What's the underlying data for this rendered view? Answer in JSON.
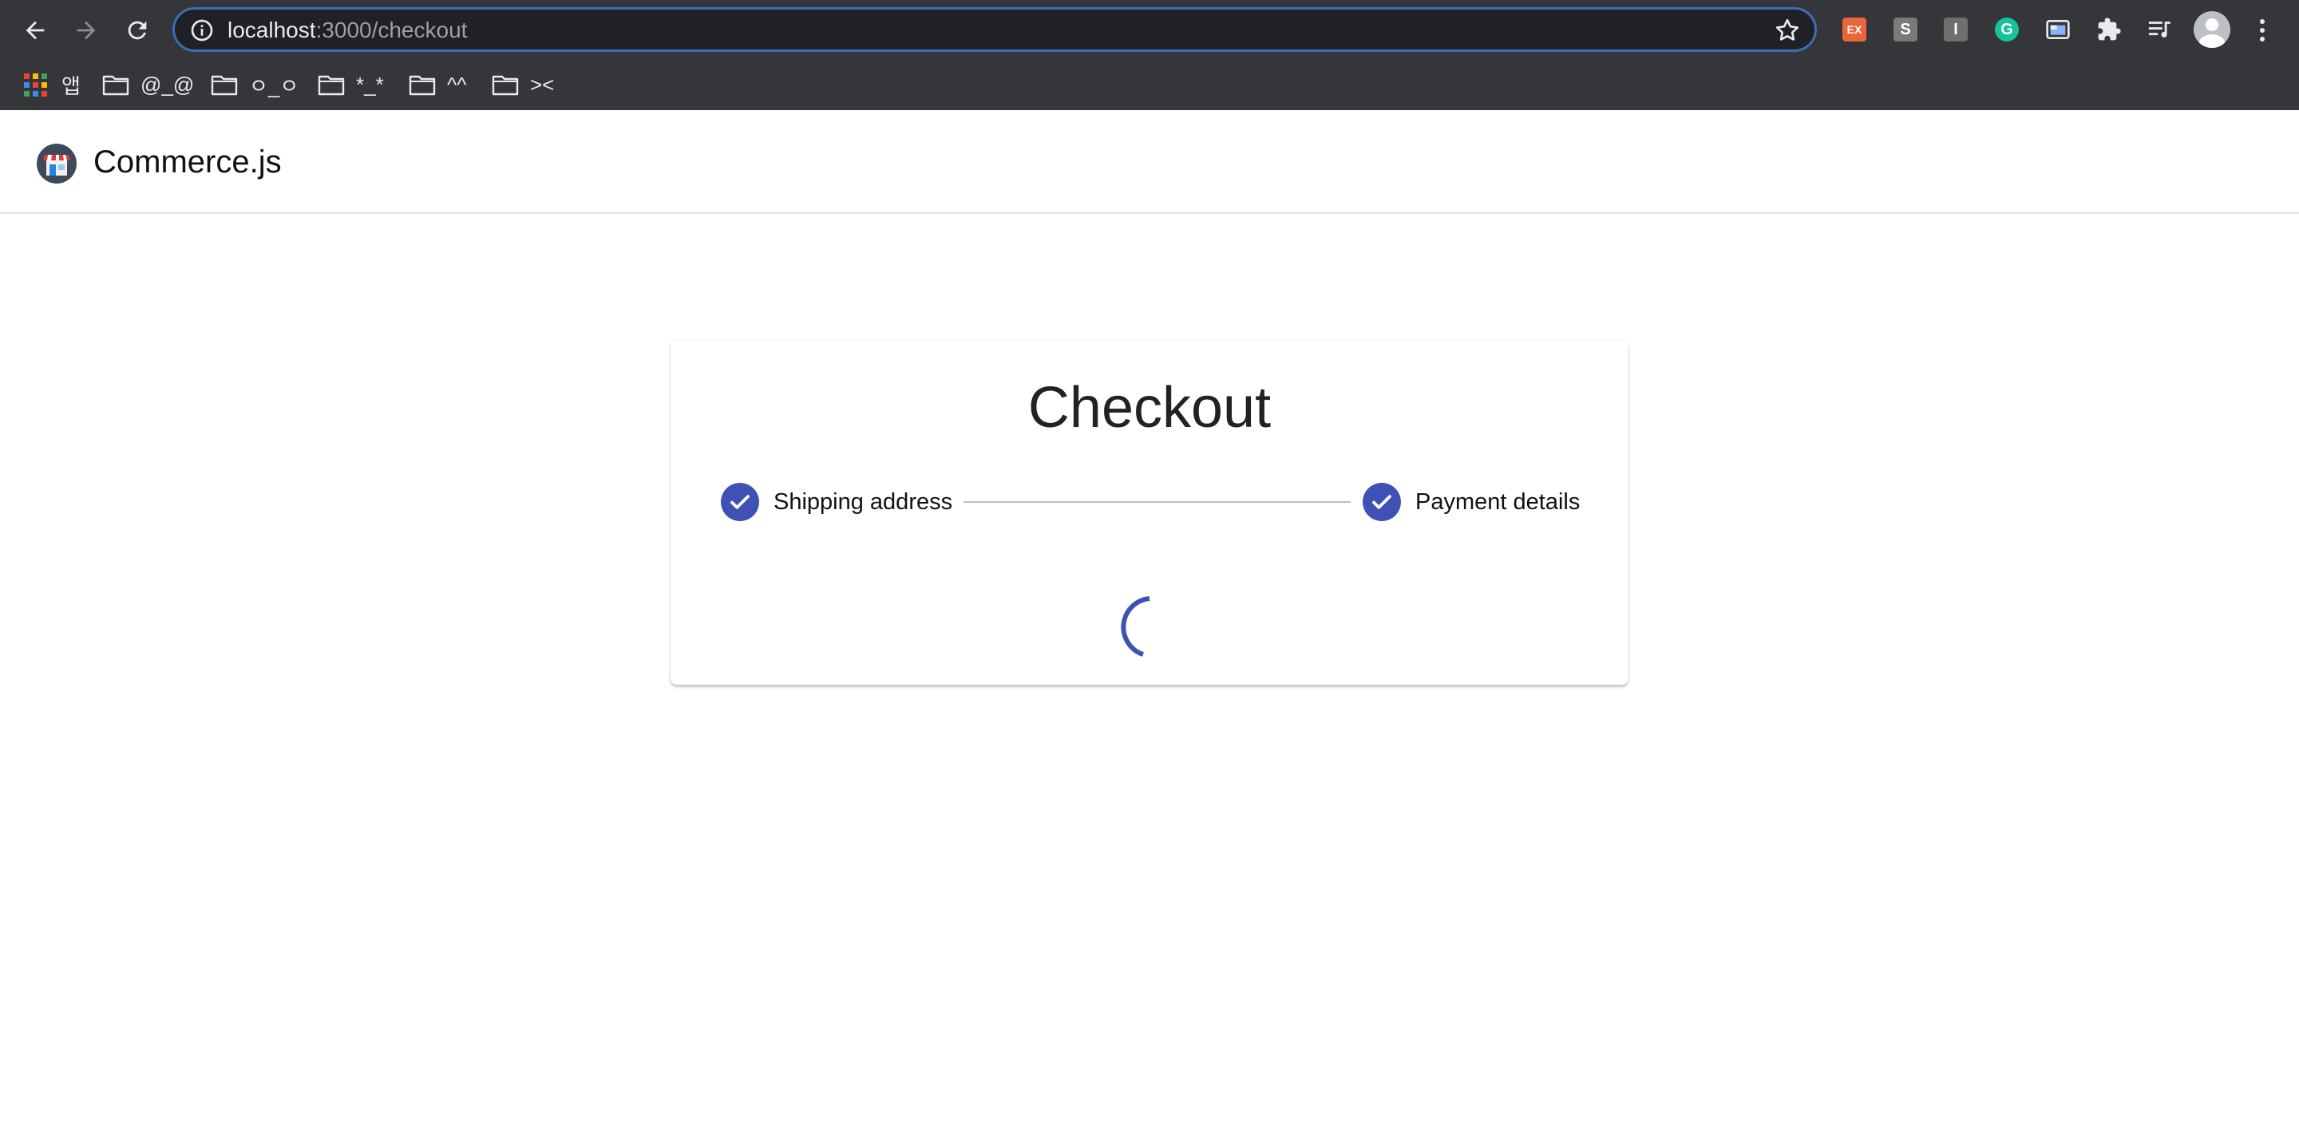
{
  "browser": {
    "url_host": "localhost",
    "url_path": ":3000/checkout",
    "extensions": [
      {
        "name": "ex-extension",
        "label": "EX",
        "color": "#e8673a"
      },
      {
        "name": "s-extension",
        "label": "S",
        "color": "#7a7a7a"
      },
      {
        "name": "i-extension",
        "label": "I",
        "color": "#6f6f6f"
      },
      {
        "name": "grammarly-extension",
        "label": "G",
        "color": "#15c39a"
      }
    ],
    "bookmarks": [
      {
        "label": "앱",
        "icon": "apps-grid-icon"
      },
      {
        "label": "@_@",
        "icon": "folder-icon"
      },
      {
        "label": "ㅇ_ㅇ",
        "icon": "folder-icon"
      },
      {
        "label": "*_*",
        "icon": "folder-icon"
      },
      {
        "label": "^^",
        "icon": "folder-icon"
      },
      {
        "label": "><",
        "icon": "folder-icon"
      }
    ]
  },
  "app": {
    "brand_name": "Commerce.js"
  },
  "checkout": {
    "title": "Checkout",
    "steps": [
      {
        "label": "Shipping address",
        "status": "completed"
      },
      {
        "label": "Payment details",
        "status": "completed"
      }
    ],
    "loading": true
  },
  "colors": {
    "accent": "#3f51b5",
    "chrome_bg": "#35363a",
    "omnibox_bg": "#202124",
    "omnibox_focus": "#3a6fb5"
  }
}
